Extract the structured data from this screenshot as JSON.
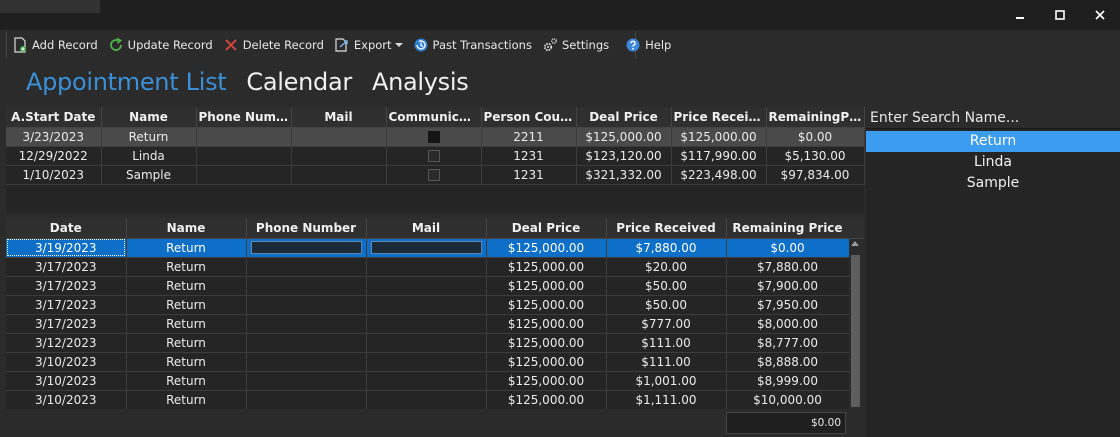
{
  "toolbar": {
    "add_record": "Add Record",
    "update_record": "Update Record",
    "delete_record": "Delete Record",
    "export": "Export",
    "past_transactions": "Past Transactions",
    "settings": "Settings",
    "help": "Help"
  },
  "tabs": [
    "Appointment List",
    "Calendar",
    "Analysis"
  ],
  "appointments": {
    "columns": [
      "A.Start Date",
      "Name",
      "Phone Num...",
      "Mail",
      "Communica...",
      "Person Count",
      "Deal Price",
      "Price Received",
      "RemainingPr..."
    ],
    "rows": [
      {
        "start_date": "3/23/2023",
        "name": "Return",
        "phone": "",
        "mail": "",
        "communication": true,
        "person_count": "2211",
        "deal_price": "$125,000.00",
        "price_received": "$125,000.00",
        "remaining": "$0.00"
      },
      {
        "start_date": "12/29/2022",
        "name": "Linda",
        "phone": "",
        "mail": "",
        "communication": false,
        "person_count": "1231",
        "deal_price": "$123,120.00",
        "price_received": "$117,990.00",
        "remaining": "$5,130.00"
      },
      {
        "start_date": "1/10/2023",
        "name": "Sample",
        "phone": "",
        "mail": "",
        "communication": false,
        "person_count": "1231",
        "deal_price": "$321,332.00",
        "price_received": "$223,498.00",
        "remaining": "$97,834.00"
      }
    ]
  },
  "transactions": {
    "columns": [
      "Date",
      "Name",
      "Phone Number",
      "Mail",
      "Deal Price",
      "Price Received",
      "Remaining Price"
    ],
    "rows": [
      {
        "date": "3/19/2023",
        "name": "Return",
        "phone": "",
        "mail": "",
        "deal_price": "$125,000.00",
        "price_received": "$7,880.00",
        "remaining": "$0.00"
      },
      {
        "date": "3/17/2023",
        "name": "Return",
        "phone": "",
        "mail": "",
        "deal_price": "$125,000.00",
        "price_received": "$20.00",
        "remaining": "$7,880.00"
      },
      {
        "date": "3/17/2023",
        "name": "Return",
        "phone": "",
        "mail": "",
        "deal_price": "$125,000.00",
        "price_received": "$50.00",
        "remaining": "$7,900.00"
      },
      {
        "date": "3/17/2023",
        "name": "Return",
        "phone": "",
        "mail": "",
        "deal_price": "$125,000.00",
        "price_received": "$50.00",
        "remaining": "$7,950.00"
      },
      {
        "date": "3/17/2023",
        "name": "Return",
        "phone": "",
        "mail": "",
        "deal_price": "$125,000.00",
        "price_received": "$777.00",
        "remaining": "$8,000.00"
      },
      {
        "date": "3/12/2023",
        "name": "Return",
        "phone": "",
        "mail": "",
        "deal_price": "$125,000.00",
        "price_received": "$111.00",
        "remaining": "$8,777.00"
      },
      {
        "date": "3/10/2023",
        "name": "Return",
        "phone": "",
        "mail": "",
        "deal_price": "$125,000.00",
        "price_received": "$111.00",
        "remaining": "$8,888.00"
      },
      {
        "date": "3/10/2023",
        "name": "Return",
        "phone": "",
        "mail": "",
        "deal_price": "$125,000.00",
        "price_received": "$1,001.00",
        "remaining": "$8,999.00"
      },
      {
        "date": "3/10/2023",
        "name": "Return",
        "phone": "",
        "mail": "",
        "deal_price": "$125,000.00",
        "price_received": "$1,111.00",
        "remaining": "$10,000.00"
      }
    ],
    "total": "$0.00"
  },
  "search": {
    "placeholder": "Enter Search Name...",
    "results": [
      "Return",
      "Linda",
      "Sample"
    ]
  },
  "colors": {
    "accent": "#3a8fd6",
    "selection": "#0d6fc7",
    "search_selection": "#3c9cf0"
  }
}
